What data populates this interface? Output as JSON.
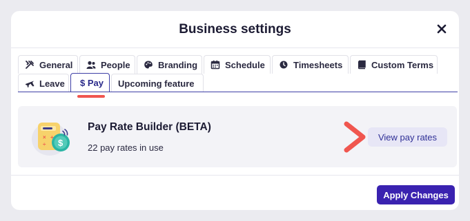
{
  "modal": {
    "title": "Business settings",
    "close_icon": "close-icon"
  },
  "tabs": [
    {
      "label": "General",
      "icon": "tools-icon"
    },
    {
      "label": "People",
      "icon": "people-icon"
    },
    {
      "label": "Branding",
      "icon": "palette-icon"
    },
    {
      "label": "Schedule",
      "icon": "calendar-icon"
    },
    {
      "label": "Timesheets",
      "icon": "clock-icon"
    },
    {
      "label": "Custom Terms",
      "icon": "book-icon"
    },
    {
      "label": "Leave",
      "icon": "plane-icon"
    },
    {
      "label": "$ Pay",
      "icon": "",
      "active": true
    },
    {
      "label": "Upcoming feature",
      "icon": ""
    }
  ],
  "card": {
    "icon": "calculator-coin-icon",
    "title": "Pay Rate Builder (BETA)",
    "subtitle": "22 pay rates in use",
    "button_label": "View pay rates"
  },
  "footer": {
    "apply_label": "Apply Changes"
  },
  "colors": {
    "accent": "#3a22b0",
    "annotation": "#f0564f",
    "card_background": "#f3f3f7"
  }
}
